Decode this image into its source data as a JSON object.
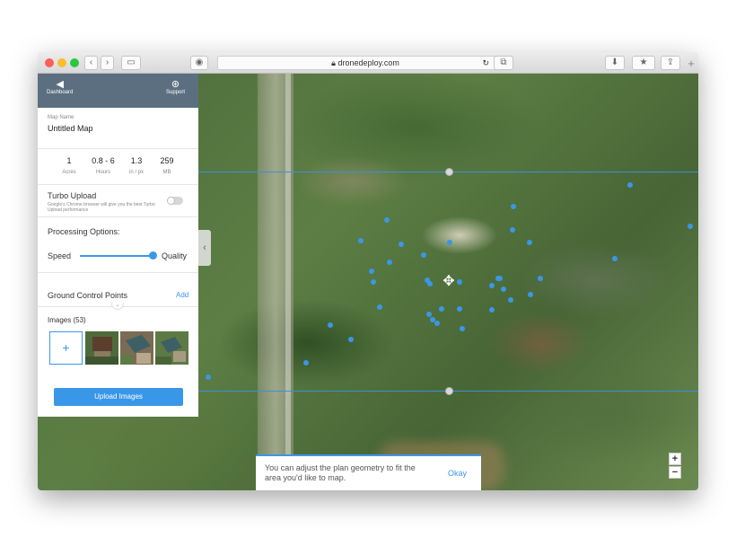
{
  "browser": {
    "url": "dronedeploy.com",
    "lock_icon": "lock-icon"
  },
  "sidebar": {
    "header": {
      "dashboard_label": "Dashboard",
      "support_label": "Support"
    },
    "map_name": {
      "label": "Map Name",
      "value": "Untitled Map"
    },
    "stats": [
      {
        "value": "1",
        "unit": "Acres"
      },
      {
        "value": "0.8 - 6",
        "unit": "Hours"
      },
      {
        "value": "1.3",
        "unit": "in / px"
      },
      {
        "value": "259",
        "unit": "MB"
      }
    ],
    "turbo": {
      "title": "Turbo Upload",
      "description": "Google's Chrome browser will give you the best Turbo Upload performance",
      "enabled": false
    },
    "processing": {
      "title": "Processing Options:",
      "left_label": "Speed",
      "right_label": "Quality",
      "value": 1.0
    },
    "gcp": {
      "title": "Ground Control Points",
      "add_label": "Add"
    },
    "images": {
      "title": "Images (53)",
      "add_symbol": "+"
    },
    "upload_label": "Upload Images"
  },
  "map": {
    "zoom_in": "+",
    "zoom_out": "−"
  },
  "toast": {
    "message": "You can adjust the plan geometry to fit the area you'd like to map.",
    "okay_label": "Okay"
  },
  "colors": {
    "accent": "#3a97e8",
    "header": "#5b6f80"
  }
}
